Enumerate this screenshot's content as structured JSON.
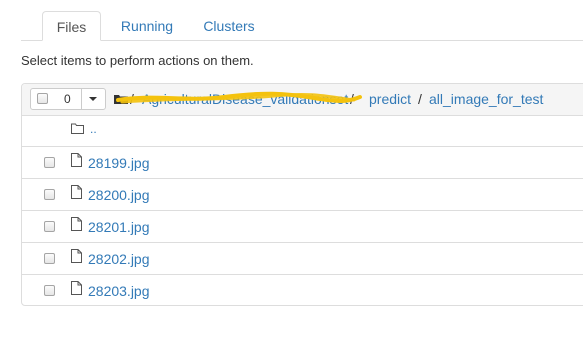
{
  "tabs": [
    {
      "label": "Files",
      "active": true
    },
    {
      "label": "Running",
      "active": false
    },
    {
      "label": "Clusters",
      "active": false
    }
  ],
  "instructions": "Select items to perform actions on them.",
  "selection": {
    "count": "0"
  },
  "breadcrumb": {
    "folder_icon": "folder-icon",
    "items": [
      "AgriculturalDisease_validationset",
      "predict",
      "all_image_for_test"
    ],
    "separator": "/"
  },
  "parent_dir": {
    "label": ".."
  },
  "files": [
    {
      "name": "28199.jpg",
      "icon": "file-icon"
    },
    {
      "name": "28200.jpg",
      "icon": "file-icon"
    },
    {
      "name": "28201.jpg",
      "icon": "file-icon"
    },
    {
      "name": "28202.jpg",
      "icon": "file-icon"
    },
    {
      "name": "28203.jpg",
      "icon": "file-icon"
    }
  ],
  "colors": {
    "link": "#337ab7",
    "border": "#dddddd",
    "header_bg": "#f5f5f5",
    "redaction": "#f4c20d"
  }
}
